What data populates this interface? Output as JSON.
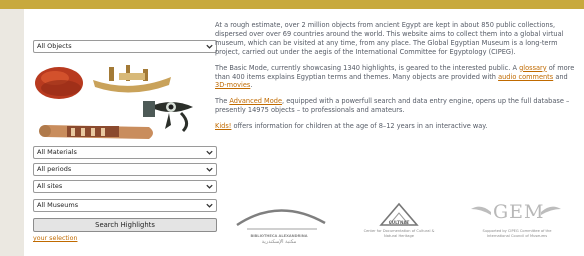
{
  "filters": {
    "objects": "All Objects",
    "materials": "All Materials",
    "periods": "All periods",
    "sites": "All sites",
    "museums": "All Museums"
  },
  "search_button": "Search Highlights",
  "your_selection": "your selection",
  "intro": {
    "p1": "At a rough estimate, over 2 million objects from ancient Egypt are kept in about 850 public collections, dispersed over over 69 countries around the world. This website aims to collect them into a global virtual museum, which can be visited at any time, from any place. The Global Egyptian Museum is a long-term project, carried out under the aegis of the International Committee for Egyptology (CIPEG).",
    "p2_a": "The Basic Mode, currently showcasing 1340 highlights, is geared to the interested public. A ",
    "p2_glossary": "glossary",
    "p2_b": " of more than 400 items explains Egyptian terms and themes. Many objects are provided with ",
    "p2_audio": "audio comments",
    "p2_c": " and ",
    "p2_movies": "3D-movies",
    "p2_d": ".",
    "p3_a": "The ",
    "p3_advanced": "Advanced Mode",
    "p3_b": ", equipped with a powerfull search and data entry engine, opens up the full database – presently 14975 objects – to professionals and amateurs.",
    "p4_kids": "Kids!",
    "p4_b": " offers information for children at the age of 8–12 years in an interactive way."
  },
  "logos": {
    "alexandrina_title": "BIBLIOTHECA ALEXANDRINA",
    "alexandrina_arabic": "مكتبة الإسكندرية",
    "cultnat_title": "CULTNAT",
    "cultnat_sub": "Center for Documentation of Cultural & Natural Heritage",
    "gem_title": "GEM",
    "gem_sub": "Supported by CIPEG Committee of the International Council of Museums"
  }
}
